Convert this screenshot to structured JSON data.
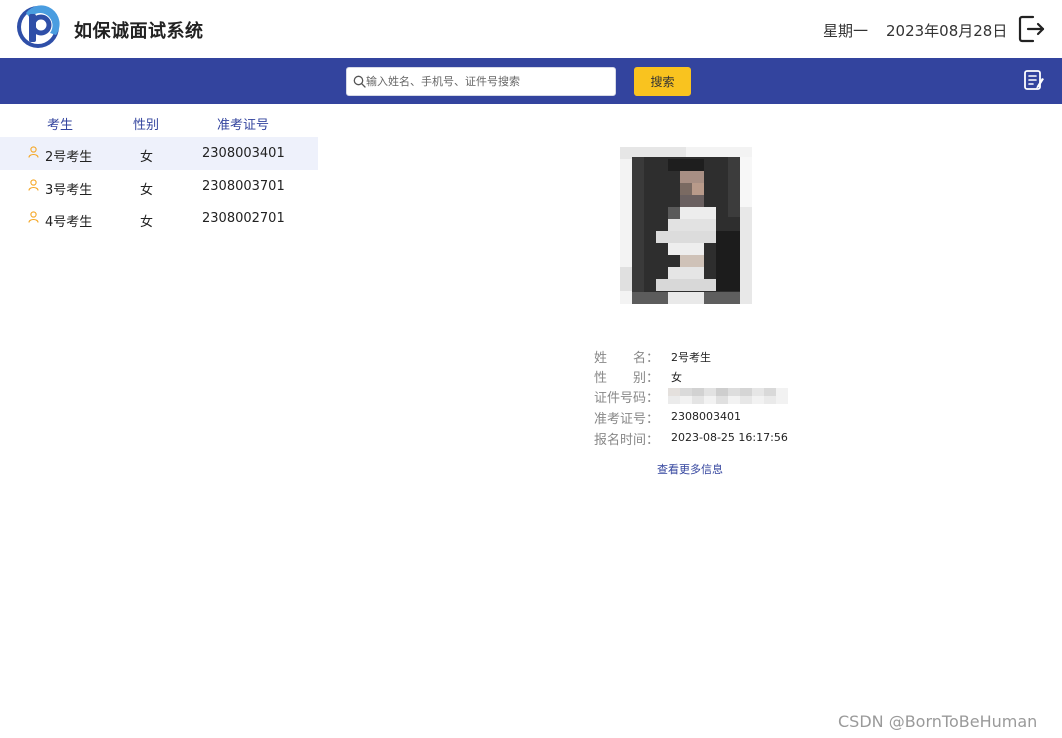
{
  "header": {
    "title": "如保诚面试系统",
    "weekday": "星期一",
    "date": "2023年08月28日"
  },
  "navbar": {
    "search_placeholder": "输入姓名、手机号、证件号搜索",
    "search_value": "",
    "search_button": "搜索"
  },
  "table": {
    "columns": [
      "考生",
      "性别",
      "准考证号"
    ],
    "rows": [
      {
        "name": "2号考生",
        "gender": "女",
        "ticket": "2308003401",
        "selected": true
      },
      {
        "name": "3号考生",
        "gender": "女",
        "ticket": "2308003701",
        "selected": false
      },
      {
        "name": "4号考生",
        "gender": "女",
        "ticket": "2308002701",
        "selected": false
      }
    ]
  },
  "detail": {
    "labels": {
      "name": "姓　　名：",
      "gender": "性　　别：",
      "id_number": "证件号码：",
      "ticket": "准考证号：",
      "register_time": "报名时间："
    },
    "values": {
      "name": "2号考生",
      "gender": "女",
      "ticket": "2308003401",
      "register_time": "2023-08-25 16:17:56"
    },
    "more_link": "查看更多信息"
  },
  "watermark": "CSDN @BornToBeHuman",
  "colors": {
    "navbar": "#33449e",
    "search_button": "#f9c31f",
    "header_text": "#33449e",
    "selected_row": "#eef1fb"
  }
}
